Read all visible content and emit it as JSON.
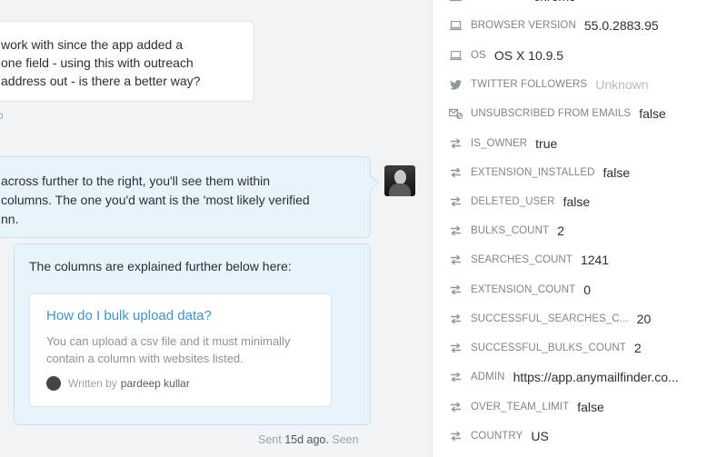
{
  "conversation": {
    "user_message_lines": [
      "work with since the app added a",
      "one field - using this with outreach",
      "address out - is there a better way?"
    ],
    "user_meta": "o",
    "admin_message_lines": [
      "across further to the right, you'll see them within",
      "columns. The one you'd want is the 'most likely verified",
      "nn."
    ],
    "article_intro": "The columns are explained further below here:",
    "article_card": {
      "title": "How do I bulk upload data?",
      "description": "You can upload a csv file and it must minimally contain a column with websites listed.",
      "written_by_label": "Written by",
      "author": "pardeep kullar"
    },
    "sent_label": "Sent",
    "sent_age": "15d ago.",
    "seen_label": "Seen"
  },
  "attributes": [
    {
      "icon": "laptop-icon",
      "key": "Browser",
      "value": "chrome"
    },
    {
      "icon": "laptop-icon",
      "key": "Browser version",
      "value": "55.0.2883.95"
    },
    {
      "icon": "laptop-icon",
      "key": "OS",
      "value": "OS X 10.9.5"
    },
    {
      "icon": "twitter-icon",
      "key": "Twitter followers",
      "value": "Unknown",
      "muted": true
    },
    {
      "icon": "unsubscribed-mail-icon",
      "key": "Unsubscribed from emails",
      "value": "false"
    },
    {
      "icon": "custom-attribute-icon",
      "key": "is_owner",
      "value": "true"
    },
    {
      "icon": "custom-attribute-icon",
      "key": "extension_installed",
      "value": "false"
    },
    {
      "icon": "custom-attribute-icon",
      "key": "deleted_user",
      "value": "false"
    },
    {
      "icon": "custom-attribute-icon",
      "key": "bulks_count",
      "value": "2"
    },
    {
      "icon": "custom-attribute-icon",
      "key": "searches_count",
      "value": "1241"
    },
    {
      "icon": "custom-attribute-icon",
      "key": "extension_count",
      "value": "0"
    },
    {
      "icon": "custom-attribute-icon",
      "key": "successful_searches_c...",
      "value": "20"
    },
    {
      "icon": "custom-attribute-icon",
      "key": "successful_bulks_count",
      "value": "2"
    },
    {
      "icon": "custom-attribute-icon",
      "key": "admin",
      "value": "https://app.anymailfinder.co..."
    },
    {
      "icon": "custom-attribute-icon",
      "key": "over_team_limit",
      "value": "false"
    },
    {
      "icon": "custom-attribute-icon",
      "key": "country",
      "value": "US"
    }
  ]
}
